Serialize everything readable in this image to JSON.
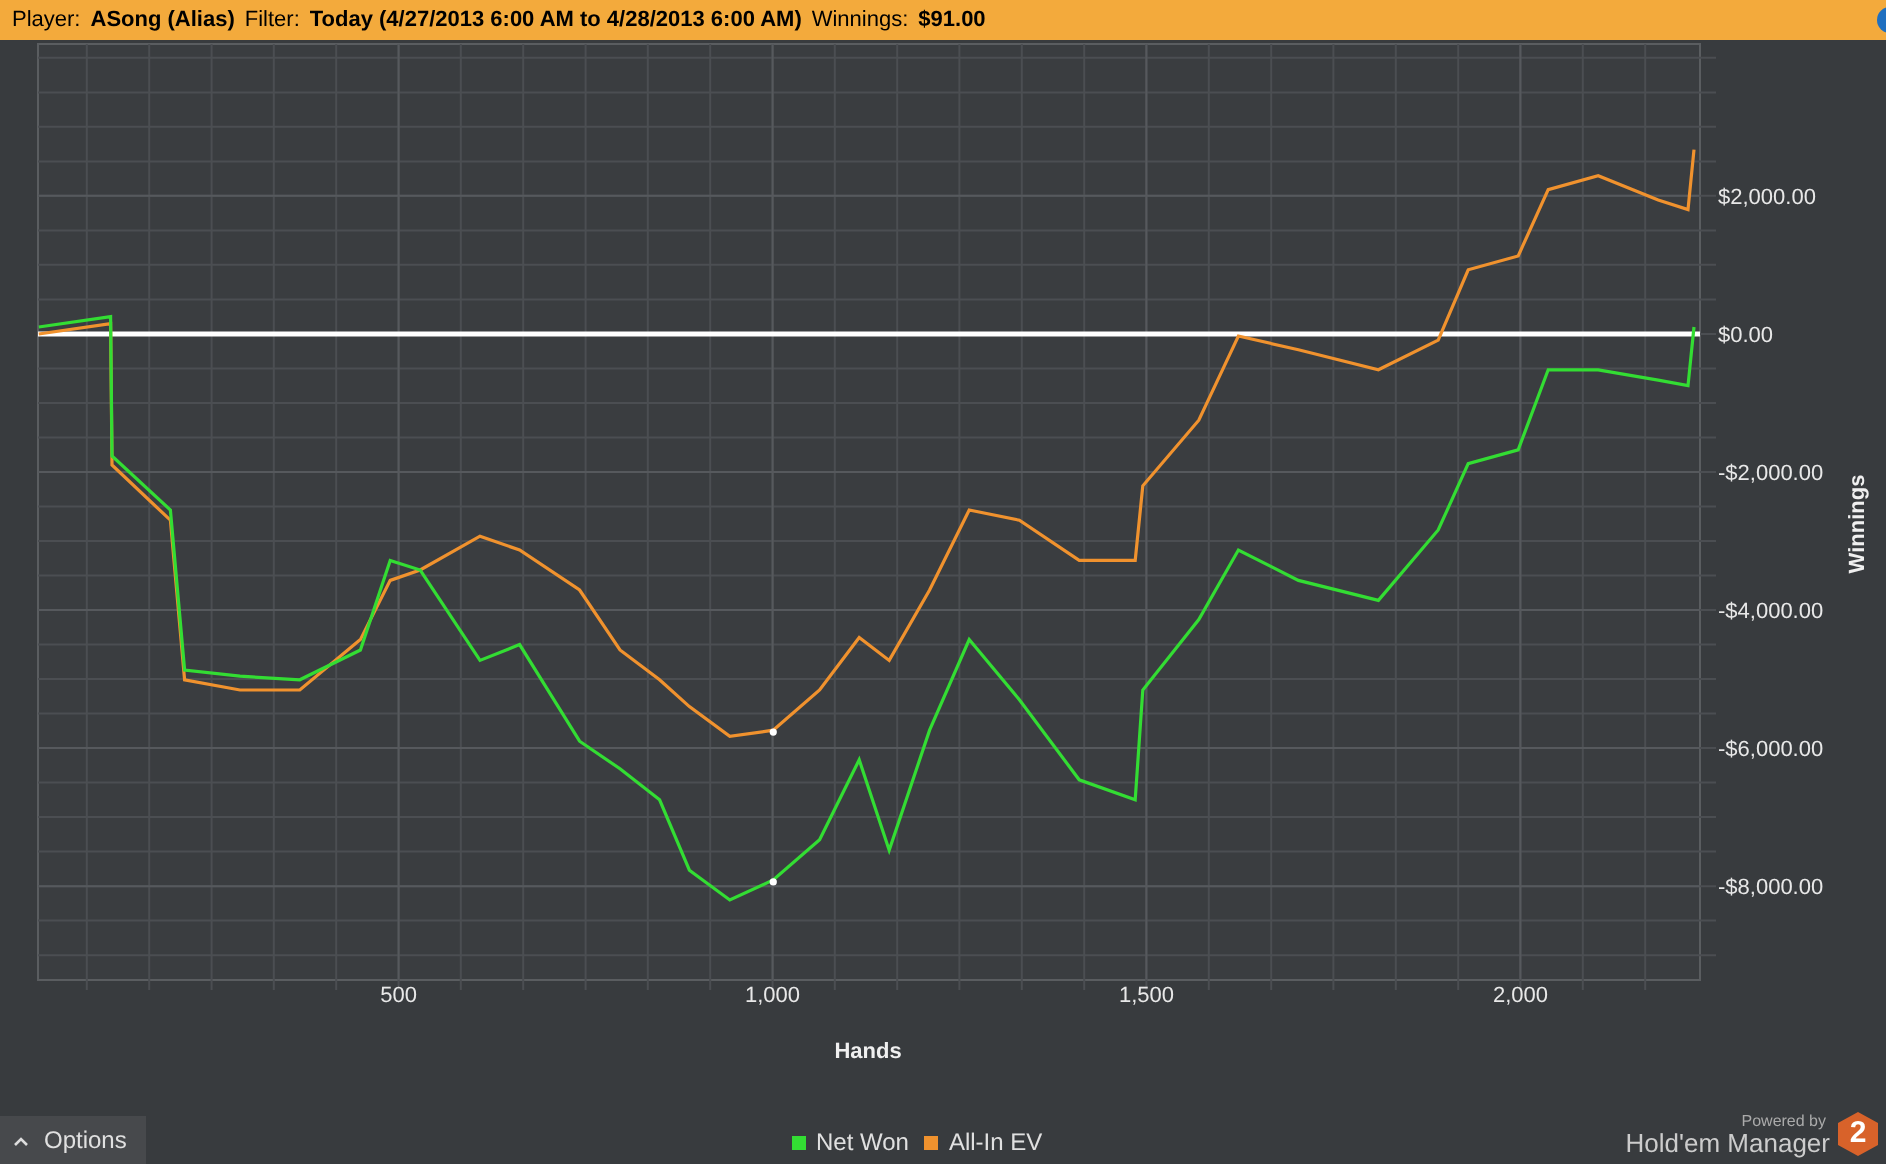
{
  "header": {
    "player_label": "Player:",
    "player": "ASong (Alias)",
    "filter_label": "Filter:",
    "filter": "Today (4/27/2013 6:00 AM to 4/28/2013 6:00 AM)",
    "winnings_label": "Winnings:",
    "winnings": "$91.00"
  },
  "chart": {
    "chart_data": {
      "type": "line",
      "grid": true,
      "xlabel": "Hands",
      "ylabel": "Winnings",
      "xlim": [
        18,
        2240
      ],
      "ylim": [
        -9360,
        4200
      ],
      "xticks": [
        {
          "value": 500,
          "label": "500"
        },
        {
          "value": 1000,
          "label": "1,000"
        },
        {
          "value": 1500,
          "label": "1,500"
        },
        {
          "value": 2000,
          "label": "2,000"
        }
      ],
      "yticks": [
        {
          "value": 2000,
          "label": "$2,000.00"
        },
        {
          "value": 0,
          "label": "$0.00"
        },
        {
          "value": -2000,
          "label": "-$2,000.00"
        },
        {
          "value": -4000,
          "label": "-$4,000.00"
        },
        {
          "value": -6000,
          "label": "-$6,000.00"
        },
        {
          "value": -8000,
          "label": "-$8,000.00"
        }
      ],
      "x": [
        19,
        115,
        117,
        195,
        214,
        288,
        368,
        449,
        489,
        529,
        609,
        662,
        742,
        796,
        849,
        889,
        943,
        1001,
        1063,
        1116,
        1156,
        1210,
        1263,
        1330,
        1410,
        1485,
        1495,
        1570,
        1623,
        1703,
        1810,
        1890,
        1930,
        1997,
        2037,
        2104,
        2184,
        2224,
        2232
      ],
      "series": [
        {
          "name": "Net Won",
          "color": "#33dd33",
          "values": [
            100,
            250,
            -1770,
            -2550,
            -4870,
            -4960,
            -5010,
            -4580,
            -3280,
            -3420,
            -4730,
            -4500,
            -5900,
            -6300,
            -6750,
            -7770,
            -8200,
            -7910,
            -7330,
            -6170,
            -7480,
            -5740,
            -4430,
            -5300,
            -6460,
            -6750,
            -5160,
            -4140,
            -3130,
            -3570,
            -3860,
            -2840,
            -1880,
            -1680,
            -520,
            -520,
            -670,
            -750,
            100
          ]
        },
        {
          "name": "All-In EV",
          "color": "#f0922e",
          "values": [
            0,
            150,
            -1900,
            -2700,
            -5010,
            -5160,
            -5160,
            -4430,
            -3570,
            -3420,
            -2930,
            -3130,
            -3710,
            -4580,
            -5010,
            -5400,
            -5830,
            -5740,
            -5160,
            -4400,
            -4730,
            -3710,
            -2550,
            -2700,
            -3280,
            -3280,
            -2200,
            -1250,
            -30,
            -230,
            -520,
            -90,
            930,
            1130,
            2090,
            2290,
            1940,
            1800,
            2670
          ]
        }
      ]
    }
  },
  "options_button": {
    "label": "Options"
  },
  "branding": {
    "powered_by": "Powered by",
    "product": "Hold'em Manager",
    "badge": "2"
  }
}
